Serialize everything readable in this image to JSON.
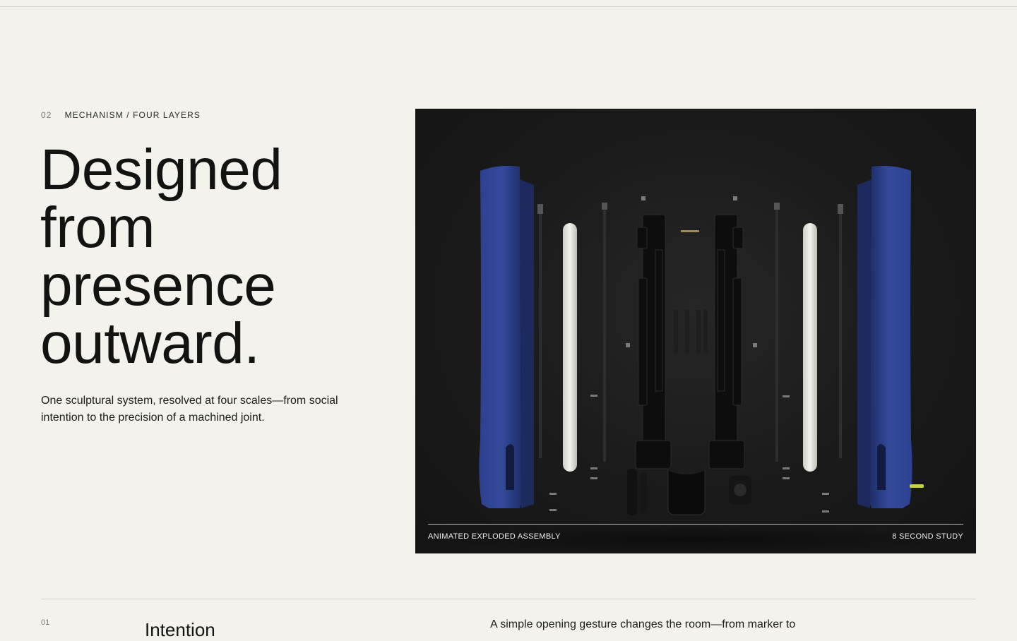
{
  "section": {
    "number": "02",
    "label": "MECHANISM / FOUR LAYERS",
    "headline_lines": [
      "Designed",
      "from",
      "presence",
      "outward."
    ],
    "description": "One sculptural system, resolved at four scales—from social intention to the precision of a machined joint."
  },
  "media": {
    "caption_left": "ANIMATED EXPLODED ASSEMBLY",
    "caption_right": "8 SECOND STUDY"
  },
  "next_section": {
    "number": "01",
    "title": "Intention",
    "copy": "A simple opening gesture changes the room—from marker to"
  },
  "colors": {
    "background": "#f3f2ec",
    "text": "#141412",
    "panel_blue": "#2b3f86",
    "media_bg": "#1a1a1a"
  }
}
